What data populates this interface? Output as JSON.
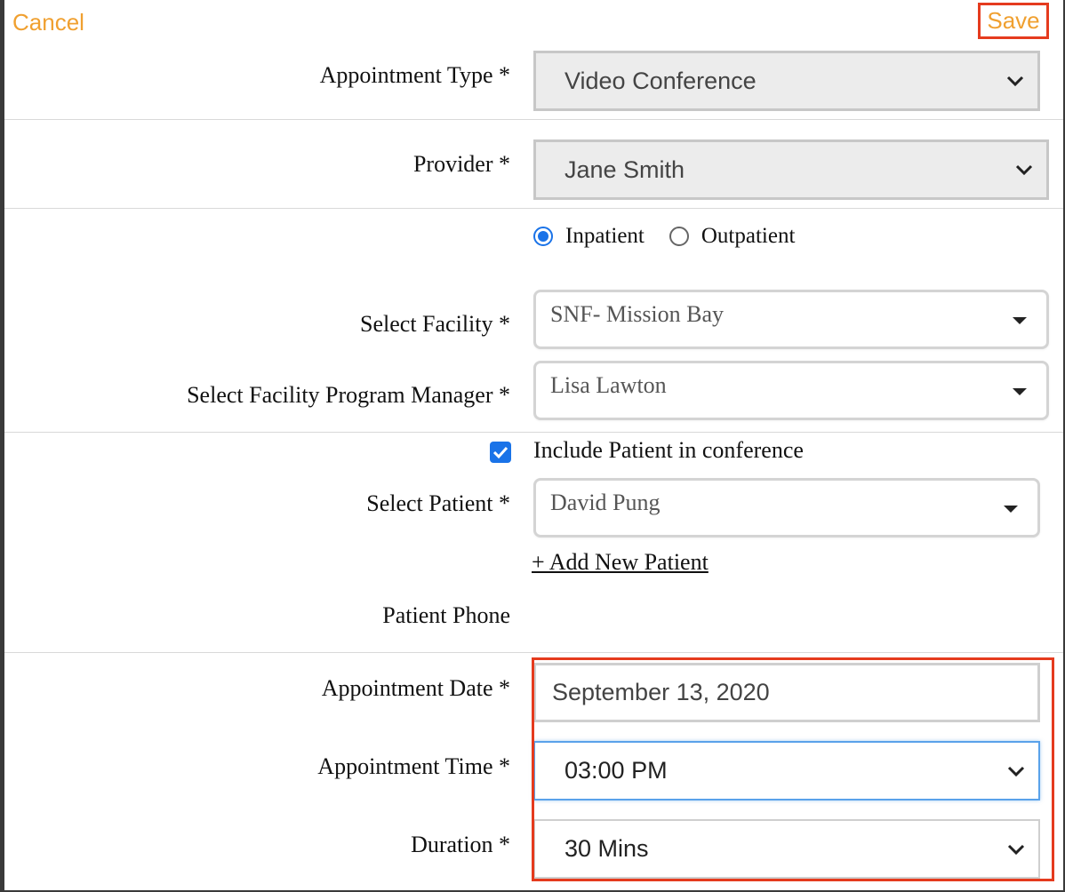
{
  "header": {
    "cancel_label": "Cancel",
    "save_label": "Save"
  },
  "appointment_type": {
    "label": "Appointment Type *",
    "value": "Video Conference"
  },
  "provider": {
    "label": "Provider *",
    "value": "Jane Smith"
  },
  "patient_type": {
    "options": [
      "Inpatient",
      "Outpatient"
    ],
    "selected": "Inpatient"
  },
  "facility": {
    "label": "Select Facility *",
    "value": "SNF- Mission Bay"
  },
  "program_manager": {
    "label": "Select Facility Program Manager *",
    "value": "Lisa Lawton"
  },
  "include_patient": {
    "label": "Include Patient in conference",
    "checked": true
  },
  "patient": {
    "label": "Select Patient *",
    "value": "David Pung",
    "add_link": "+ Add New Patient"
  },
  "patient_phone": {
    "label": "Patient Phone"
  },
  "appointment_date": {
    "label": "Appointment Date *",
    "value": "September 13, 2020"
  },
  "appointment_time": {
    "label": "Appointment Time *",
    "value": "03:00 PM"
  },
  "duration": {
    "label": "Duration *",
    "value": "30 Mins"
  },
  "colors": {
    "accent_orange": "#f0a030",
    "highlight_red": "#e53b1e",
    "primary_blue": "#1a73e8"
  }
}
